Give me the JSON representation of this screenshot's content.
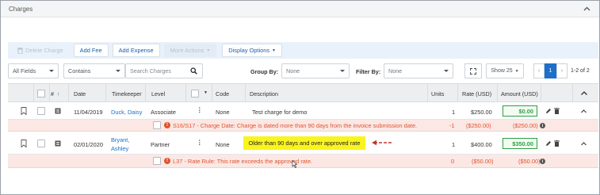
{
  "panel": {
    "title": "Charges"
  },
  "toolbar": {
    "delete_charge": "Delete Charge",
    "add_fee": "Add Fee",
    "add_expense": "Add Expense",
    "more_actions": "More Actions",
    "display_options": "Display Options"
  },
  "filters": {
    "field": "All Fields",
    "operator": "Contains",
    "search_placeholder": "Search Charges",
    "group_by_label": "Group By:",
    "group_by_value": "None",
    "filter_by_label": "Filter By:",
    "filter_by_value": "None",
    "page_size": "Show 25",
    "page_prev": "‹",
    "page_current": "1",
    "page_next": "›",
    "page_range": "1-2 of 2"
  },
  "columns": {
    "num": "#",
    "date": "Date",
    "timekeeper": "Timekeeper",
    "level": "Level",
    "code": "Code",
    "description": "Description",
    "units": "Units",
    "rate": "Rate (USD)",
    "amount": "Amount (USD)"
  },
  "rows": [
    {
      "date": "11/04/2019",
      "timekeeper": "Duck, Daisy",
      "level": "Associate",
      "code": "None",
      "description": "Test charge for demo",
      "units": "1",
      "rate": "$250.00",
      "amount": "$0.00",
      "warning": {
        "text": "S16/S17 - Charge Date: Charge is dated more than 90 days from the invoice submission date.",
        "units": "-1",
        "rate": "($250.00)",
        "amount": "($250.00)"
      }
    },
    {
      "date": "02/01/2020",
      "timekeeper_line1": "Bryant,",
      "timekeeper_line2": "Ashley",
      "level": "Partner",
      "code": "None",
      "description": "Older than 90 days and over approved rate",
      "units": "1",
      "rate": "$400.00",
      "amount": "$350.00",
      "warning": {
        "text": "L37 - Rate Rule: This rate exceeds the approved rate.",
        "units": "0",
        "rate": "($50.00)",
        "amount": "($50.00)"
      }
    }
  ],
  "icons": {
    "collapse": "chevron-up-icon",
    "search": "search-icon",
    "expand": "expand-icon",
    "bookmark": "bookmark-icon",
    "notes": "notes-icon",
    "edit": "pencil-icon",
    "delete": "trash-icon",
    "info": "info-icon",
    "warning": "warning-icon",
    "arrow": "arrow-left-icon"
  },
  "colors": {
    "accent": "#1e6fc9",
    "warning_text": "#e0532c",
    "warning_bg": "#fbe8e5",
    "amount_green": "#2e9e45",
    "highlight": "#f9f41f",
    "arrow": "#c0392b"
  }
}
